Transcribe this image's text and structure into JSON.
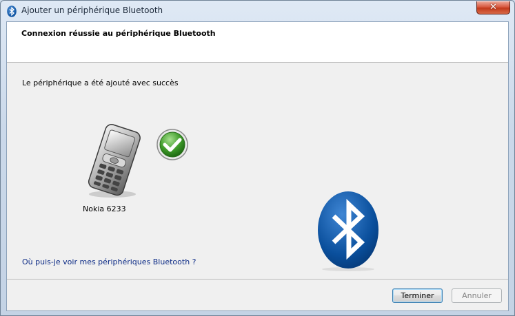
{
  "window": {
    "title": "Ajouter un périphérique Bluetooth",
    "close_label": "✕"
  },
  "header": {
    "title": "Connexion réussie au périphérique Bluetooth"
  },
  "main": {
    "status": "Le périphérique a été ajouté avec succès",
    "device_name": "Nokia 6233",
    "help_link": "Où puis-je voir mes périphériques Bluetooth ?"
  },
  "footer": {
    "finish_label": "Terminer",
    "cancel_label": "Annuler"
  },
  "icons": {
    "title": "bluetooth-icon",
    "device": "mobile-phone-icon",
    "success": "checkmark-icon",
    "brand": "bluetooth-logo-icon"
  },
  "colors": {
    "bluetooth_blue": "#0a4f9c",
    "success_green": "#3f9c2a",
    "link": "#0b2a85"
  }
}
